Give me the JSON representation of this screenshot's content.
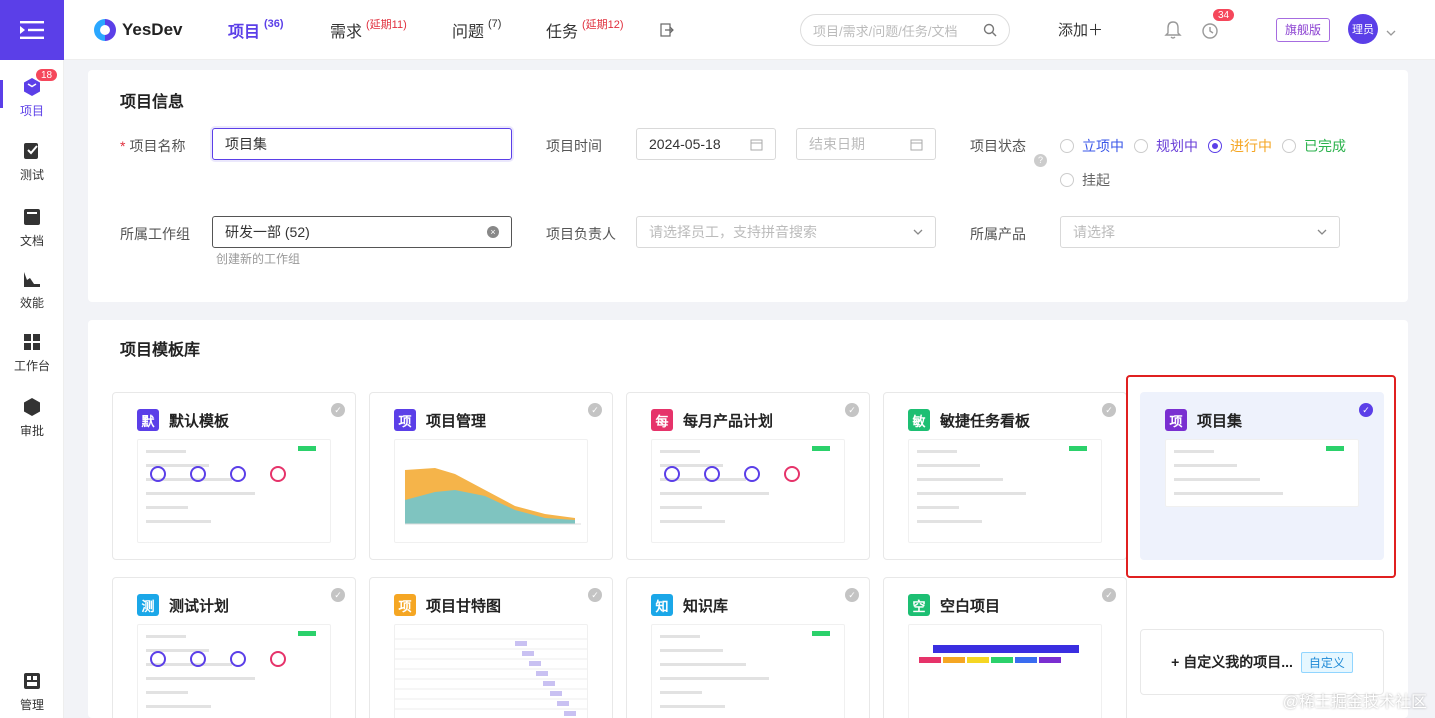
{
  "sidebar": {
    "items": [
      {
        "label": "项目",
        "badge": "18",
        "icon": "cube-icon"
      },
      {
        "label": "测试",
        "icon": "test-icon"
      },
      {
        "label": "文档",
        "icon": "document-icon"
      },
      {
        "label": "效能",
        "icon": "chart-icon"
      },
      {
        "label": "工作台",
        "icon": "workbench-icon"
      },
      {
        "label": "审批",
        "icon": "approval-icon"
      },
      {
        "label": "管理",
        "icon": "manage-icon"
      }
    ]
  },
  "topbar": {
    "logo": "YesDev",
    "nav": [
      {
        "label": "项目",
        "count": "(36)"
      },
      {
        "label": "需求",
        "count": "(延期11)"
      },
      {
        "label": "问题",
        "count": "(7)"
      },
      {
        "label": "任务",
        "count": "(延期12)"
      }
    ],
    "search_placeholder": "项目/需求/问题/任务/文档",
    "add_label": "添加＋",
    "alarm_badge": "34",
    "edition": "旗舰版",
    "avatar": "理员"
  },
  "project_info": {
    "title": "项目信息",
    "name_label": "项目名称",
    "name_value": "项目集",
    "time_label": "项目时间",
    "start_date": "2024-05-18",
    "end_placeholder": "结束日期",
    "status_label": "项目状态",
    "status_options": [
      "立项中",
      "规划中",
      "进行中",
      "已完成",
      "挂起"
    ],
    "status_selected": "进行中",
    "group_label": "所属工作组",
    "group_value": "研发一部 (52)",
    "group_link": "创建新的工作组",
    "owner_label": "项目负责人",
    "owner_placeholder": "请选择员工，支持拼音搜索",
    "product_label": "所属产品",
    "product_placeholder": "请选择"
  },
  "templates": {
    "title": "项目模板库",
    "items": [
      {
        "icon_char": "默",
        "name": "默认模板",
        "color": "#5b3fe8"
      },
      {
        "icon_char": "项",
        "name": "项目管理",
        "color": "#5b3fe8"
      },
      {
        "icon_char": "每",
        "name": "每月产品计划",
        "color": "#e6336a"
      },
      {
        "icon_char": "敏",
        "name": "敏捷任务看板",
        "color": "#1dbf73"
      },
      {
        "icon_char": "项",
        "name": "项目集",
        "color": "#7a2fd1"
      },
      {
        "icon_char": "测",
        "name": "测试计划",
        "color": "#1ba7e8"
      },
      {
        "icon_char": "项",
        "name": "项目甘特图",
        "color": "#f5a623"
      },
      {
        "icon_char": "知",
        "name": "知识库",
        "color": "#1ba7e8"
      },
      {
        "icon_char": "空",
        "name": "空白项目",
        "color": "#1dbf73"
      }
    ],
    "selected": "项目集",
    "custom_label": "+ 自定义我的项目...",
    "custom_tag": "自定义"
  },
  "watermark": "@稀土掘金技术社区",
  "colors": {
    "accent": "#5b3fe8",
    "danger": "#e0303e",
    "highlight": "#e02020"
  }
}
